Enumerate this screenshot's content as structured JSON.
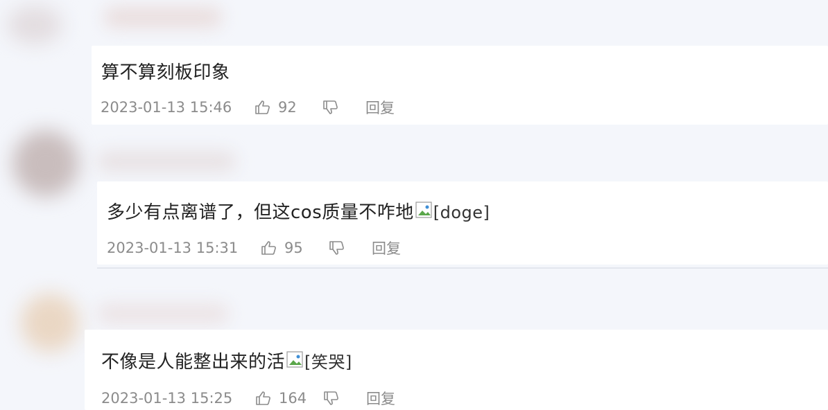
{
  "comments": [
    {
      "text": "算不算刻板印象",
      "emote_alt": "",
      "timestamp": "2023-01-13 15:46",
      "likes": "92",
      "reply_label": "回复"
    },
    {
      "text": "多少有点离谱了，但这cos质量不咋地",
      "emote_alt": "[doge]",
      "timestamp": "2023-01-13 15:31",
      "likes": "95",
      "reply_label": "回复"
    },
    {
      "text": "不像是人能整出来的活",
      "emote_alt": "[笑哭]",
      "timestamp": "2023-01-13 15:25",
      "likes": "164",
      "reply_label": "回复"
    }
  ],
  "icons": {
    "like": "thumbs-up-icon",
    "dislike": "thumbs-down-icon",
    "emote": "broken-image-icon"
  },
  "colors": {
    "background": "#f4f6fb",
    "text": "#222222",
    "meta": "#8b8b8b"
  }
}
